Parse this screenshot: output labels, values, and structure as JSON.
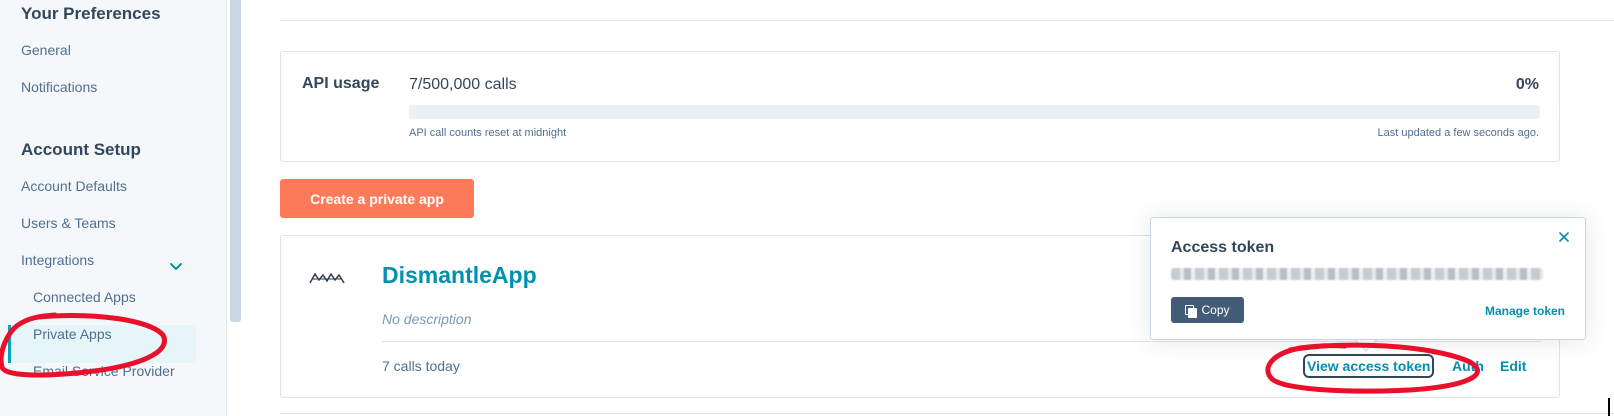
{
  "sidebar": {
    "preferences_heading": "Your Preferences",
    "general": "General",
    "notifications": "Notifications",
    "account_setup_heading": "Account Setup",
    "account_defaults": "Account Defaults",
    "users_teams": "Users & Teams",
    "integrations": "Integrations",
    "connected_apps": "Connected Apps",
    "private_apps": "Private Apps",
    "email_service_provider": "Email Service Provider"
  },
  "usage": {
    "label": "API usage",
    "calls": "7/500,000 calls",
    "percent": "0%",
    "percent_value": 0.0014,
    "reset_note": "API call counts reset at midnight",
    "updated_note": "Last updated a few seconds ago."
  },
  "create_button": "Create a private app",
  "app": {
    "name": "DismantleApp",
    "description": "No description",
    "calls_today": "7 calls today",
    "view_token": "View access token",
    "auth": "Auth",
    "edit": "Edit"
  },
  "popover": {
    "title": "Access token",
    "copy": "Copy",
    "manage": "Manage token"
  },
  "colors": {
    "accent": "#0091ae",
    "cta": "#ff7a59",
    "annotation": "#e8102a"
  }
}
